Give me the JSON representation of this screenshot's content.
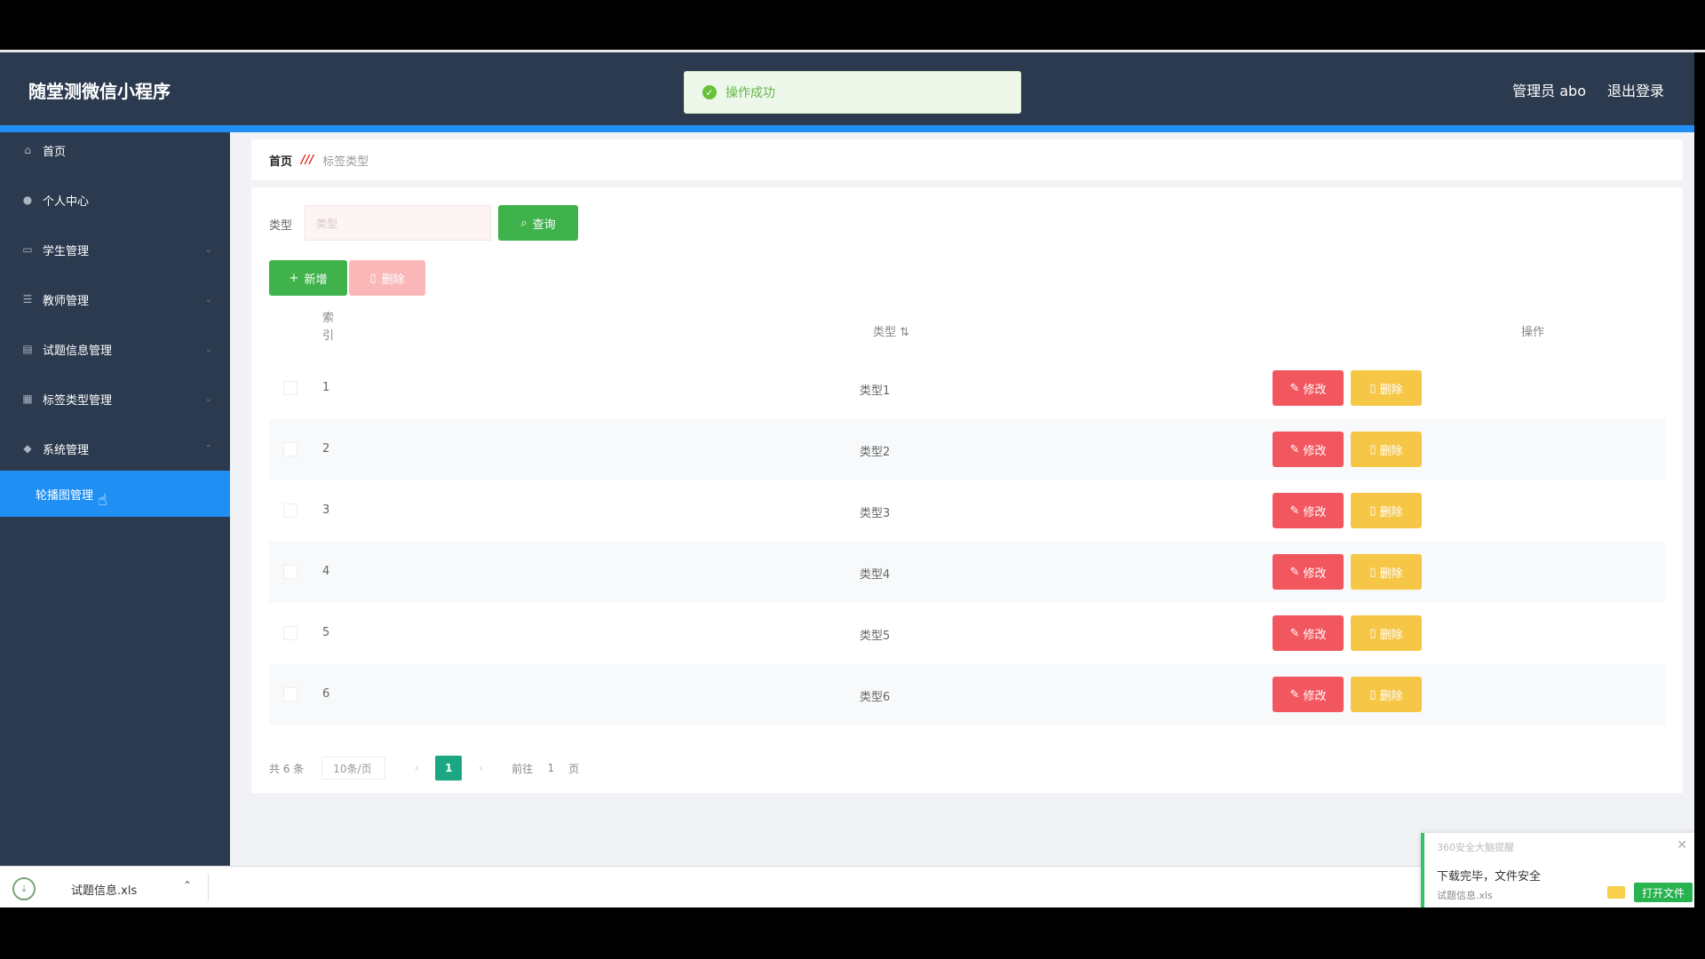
{
  "header": {
    "brand": "随堂测微信小程序",
    "admin": "管理员 abo",
    "logout": "退出登录"
  },
  "toast": {
    "message": "操作成功"
  },
  "sidebar": {
    "items": [
      {
        "label": "首页",
        "icon": "home-icon"
      },
      {
        "label": "个人中心",
        "icon": "user-icon"
      },
      {
        "label": "学生管理",
        "icon": "id-card-icon"
      },
      {
        "label": "教师管理",
        "icon": "list-icon"
      },
      {
        "label": "试题信息管理",
        "icon": "document-icon"
      },
      {
        "label": "标签类型管理",
        "icon": "grid-icon"
      },
      {
        "label": "系统管理",
        "icon": "system-icon"
      }
    ],
    "active_sub": "轮播图管理"
  },
  "breadcrumb": {
    "home": "首页",
    "separator": "///",
    "current": "标签类型"
  },
  "filter": {
    "label": "类型",
    "placeholder": "类型",
    "query_label": "查询"
  },
  "actions": {
    "add_label": "新增",
    "delete_label": "删除"
  },
  "table": {
    "headers": {
      "index": "索引",
      "type": "类型",
      "operation": "操作"
    },
    "rows": [
      {
        "index": "1",
        "type": "类型1"
      },
      {
        "index": "2",
        "type": "类型2"
      },
      {
        "index": "3",
        "type": "类型3"
      },
      {
        "index": "4",
        "type": "类型4"
      },
      {
        "index": "5",
        "type": "类型5"
      },
      {
        "index": "6",
        "type": "类型6"
      }
    ],
    "edit_label": "修改",
    "remove_label": "删除"
  },
  "pagination": {
    "total": "共 6 条",
    "page_size": "10条/页",
    "current_page": "1",
    "goto_label": "前往",
    "goto_value": "1",
    "page_suffix": "页"
  },
  "download_bar": {
    "filename": "试题信息.xls"
  },
  "download_popup": {
    "title": "360安全大脑提醒",
    "message": "下载完毕，文件安全",
    "file": "试题信息.xls",
    "open_label": "打开文件"
  }
}
